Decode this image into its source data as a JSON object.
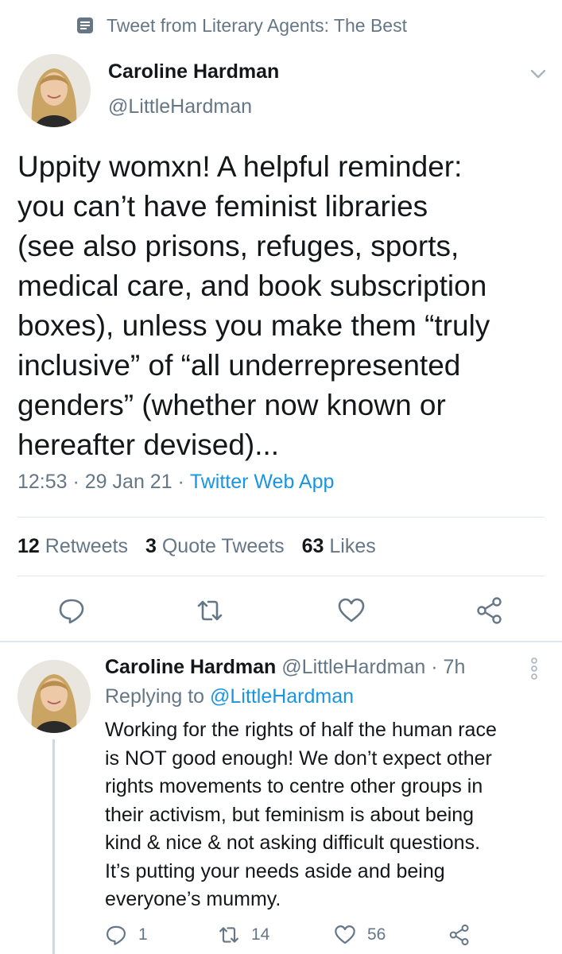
{
  "context": {
    "icon": "document-icon",
    "text": "Tweet from Literary Agents: The Best"
  },
  "tweet": {
    "author_name": "Caroline Hardman",
    "author_handle": "@LittleHardman",
    "text": "Uppity womxn! A helpful reminder:\nyou can’t have feminist libraries\n(see also prisons, refuges, sports,\nmedical care, and book subscription\nboxes), unless you make them “truly\ninclusive” of “all underrepresented\ngenders” (whether now known or\nhereafter devised)...",
    "time": "12:53",
    "date": "29 Jan 21",
    "source": "Twitter Web App",
    "retweets_count": "12",
    "retweets_label": "Retweets",
    "quotes_count": "3",
    "quotes_label": "Quote Tweets",
    "likes_count": "63",
    "likes_label": "Likes"
  },
  "reply": {
    "author_name": "Caroline Hardman",
    "author_handle": "@LittleHardman",
    "age": "7h",
    "replying_to_label": "Replying to",
    "replying_to_handle": "@LittleHardman",
    "text": "Working for the rights of half the human race\nis NOT good enough! We don’t expect other\nrights movements to centre other groups in\ntheir activism, but feminism is about being\nkind & nice & not asking difficult questions.\nIt’s putting your needs aside and being\neveryone’s mummy.",
    "replies": "1",
    "retweets": "14",
    "likes": "56"
  },
  "colors": {
    "accent": "#1b95e0",
    "muted": "#657786",
    "text": "#14171a",
    "divider": "#e1e8ed"
  }
}
